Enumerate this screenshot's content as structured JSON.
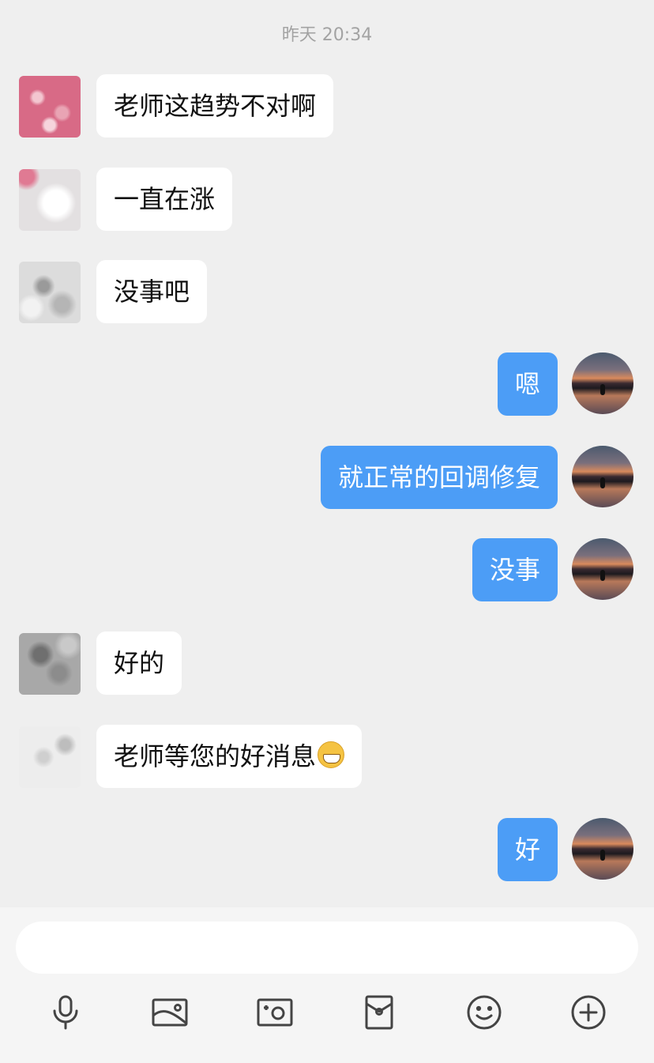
{
  "header": {
    "timestamp": "昨天 20:34"
  },
  "messages": [
    {
      "side": "left",
      "avatar": "av-pink",
      "text": "老师这趋势不对啊"
    },
    {
      "side": "left",
      "avatar": "av-whitepink",
      "text": "一直在涨"
    },
    {
      "side": "left",
      "avatar": "av-grey",
      "text": "没事吧"
    },
    {
      "side": "right",
      "avatar": "av-sunset",
      "text": "嗯"
    },
    {
      "side": "right",
      "avatar": "av-sunset",
      "text": "就正常的回调修复"
    },
    {
      "side": "right",
      "avatar": "av-sunset",
      "text": "没事"
    },
    {
      "side": "left",
      "avatar": "av-dark",
      "text": "好的"
    },
    {
      "side": "left",
      "avatar": "av-light",
      "text": "老师等您的好消息",
      "emoji": "grin-emoji"
    },
    {
      "side": "right",
      "avatar": "av-sunset",
      "text": "好"
    }
  ],
  "composer": {
    "input_value": "",
    "input_placeholder": "",
    "tools": [
      "microphone-icon",
      "image-icon",
      "camera-icon",
      "red-packet-icon",
      "emoji-icon",
      "plus-icon"
    ]
  },
  "colors": {
    "background": "#efefef",
    "outgoing_bubble": "#4c9df6",
    "incoming_bubble": "#ffffff",
    "timestamp_text": "#a3a3a3",
    "icon": "#444444"
  }
}
